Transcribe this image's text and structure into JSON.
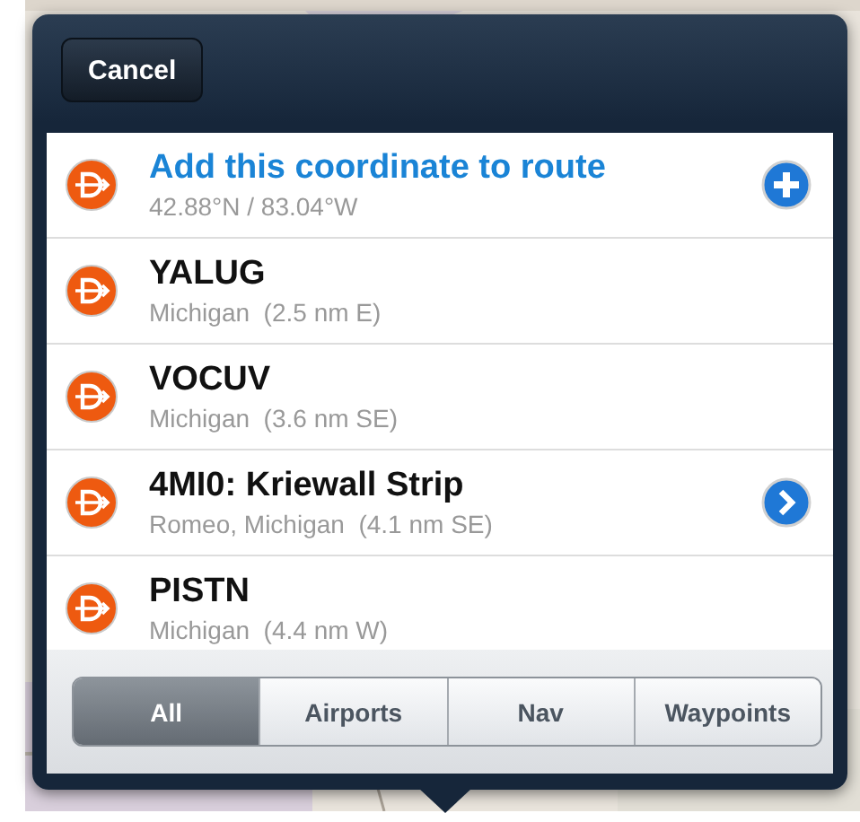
{
  "header": {
    "cancel_button": "Cancel"
  },
  "results": [
    {
      "kind": "action",
      "title": "Add this coordinate to route",
      "subtitle": "42.88°N / 83.04°W",
      "accessory": {
        "kind": "add"
      }
    },
    {
      "kind": "place",
      "title": "YALUG",
      "subtitle": "Michigan  (2.5 nm E)"
    },
    {
      "kind": "place",
      "title": "VOCUV",
      "subtitle": "Michigan  (3.6 nm SE)"
    },
    {
      "kind": "place",
      "title": "4MI0: Kriewall Strip",
      "subtitle": "Romeo, Michigan  (4.1 nm SE)",
      "accessory": {
        "kind": "detail"
      }
    },
    {
      "kind": "place",
      "title": "PISTN",
      "subtitle": "Michigan  (4.4 nm W)"
    }
  ],
  "filter_tabs": [
    {
      "label": "All",
      "selected": true
    },
    {
      "label": "Airports",
      "selected": false
    },
    {
      "label": "Nav",
      "selected": false
    },
    {
      "label": "Waypoints",
      "selected": false
    }
  ]
}
